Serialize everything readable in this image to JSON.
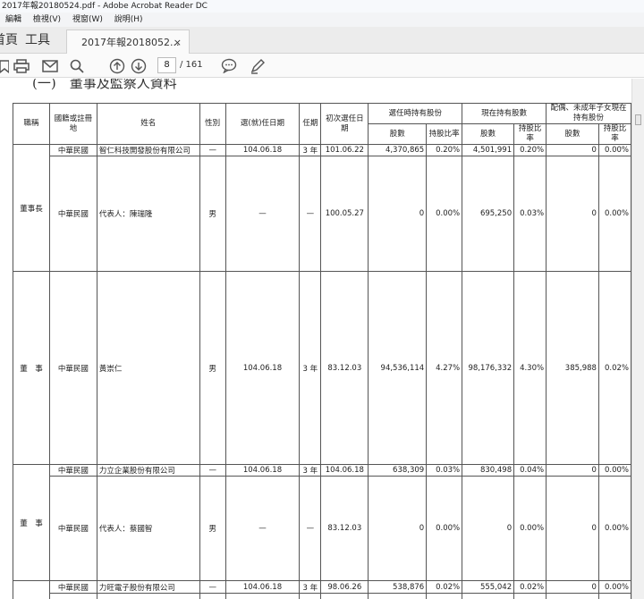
{
  "window": {
    "title": "2017年報20180524.pdf - Adobe Acrobat Reader DC"
  },
  "menu": {
    "items": [
      "編輯",
      "檢視(V)",
      "視窗(W)",
      "說明(H)"
    ]
  },
  "nav": {
    "home": "首頁",
    "tools": "工具"
  },
  "tab": {
    "label": "2017年報2018052...",
    "close": "×"
  },
  "toolbar": {
    "page_current": "8",
    "page_total": "/ 161"
  },
  "document": {
    "section_title": "(一)　董事及監察人資料",
    "headers": {
      "role": "職稱",
      "nation": "國籍或註冊地",
      "name": "姓名",
      "gender": "性別",
      "elected_date": "選(就)任日期",
      "term": "任期",
      "first_elected": "初次選任日期",
      "when_elected": "選任時持有股份",
      "current": "現在持有股數",
      "spouse": "配偶、未成年子女現在持有股份",
      "shares": "股數",
      "ratio": "持股比率"
    },
    "rows": [
      {
        "nation": "中華民國",
        "name": "智仁科技開發股份有限公司",
        "gender": "—",
        "elected": "104.06.18",
        "term": "3 年",
        "first": "101.06.22",
        "s1": "4,370,865",
        "r1": "0.20%",
        "s2": "4,501,991",
        "r2": "0.20%",
        "s3": "0",
        "r3": "0.00%"
      },
      {
        "nation": "中華民國",
        "name": "代表人：陳瑞隆",
        "gender": "男",
        "elected": "—",
        "term": "—",
        "first": "100.05.27",
        "s1": "0",
        "r1": "0.00%",
        "s2": "695,250",
        "r2": "0.03%",
        "s3": "0",
        "r3": "0.00%"
      },
      {
        "nation": "中華民國",
        "name": "黃崇仁",
        "gender": "男",
        "elected": "104.06.18",
        "term": "3 年",
        "first": "83.12.03",
        "s1": "94,536,114",
        "r1": "4.27%",
        "s2": "98,176,332",
        "r2": "4.30%",
        "s3": "385,988",
        "r3": "0.02%"
      },
      {
        "nation": "中華民國",
        "name": "力立企業股份有限公司",
        "gender": "—",
        "elected": "104.06.18",
        "term": "3 年",
        "first": "104.06.18",
        "s1": "638,309",
        "r1": "0.03%",
        "s2": "830,498",
        "r2": "0.04%",
        "s3": "0",
        "r3": "0.00%"
      },
      {
        "nation": "中華民國",
        "name": "代表人：蔡國智",
        "gender": "男",
        "elected": "—",
        "term": "—",
        "first": "83.12.03",
        "s1": "0",
        "r1": "0.00%",
        "s2": "0",
        "r2": "0.00%",
        "s3": "0",
        "r3": "0.00%"
      },
      {
        "nation": "中華民國",
        "name": "力旺電子股份有限公司",
        "gender": "—",
        "elected": "104.06.18",
        "term": "3 年",
        "first": "98.06.26",
        "s1": "538,876",
        "r1": "0.02%",
        "s2": "555,042",
        "r2": "0.02%",
        "s3": "0",
        "r3": "0.00%"
      }
    ],
    "roles": [
      "董事長",
      "董　事",
      "董　事"
    ]
  },
  "colors": {
    "accent": "#3c6fb0",
    "tab_bg": "#ececec"
  }
}
